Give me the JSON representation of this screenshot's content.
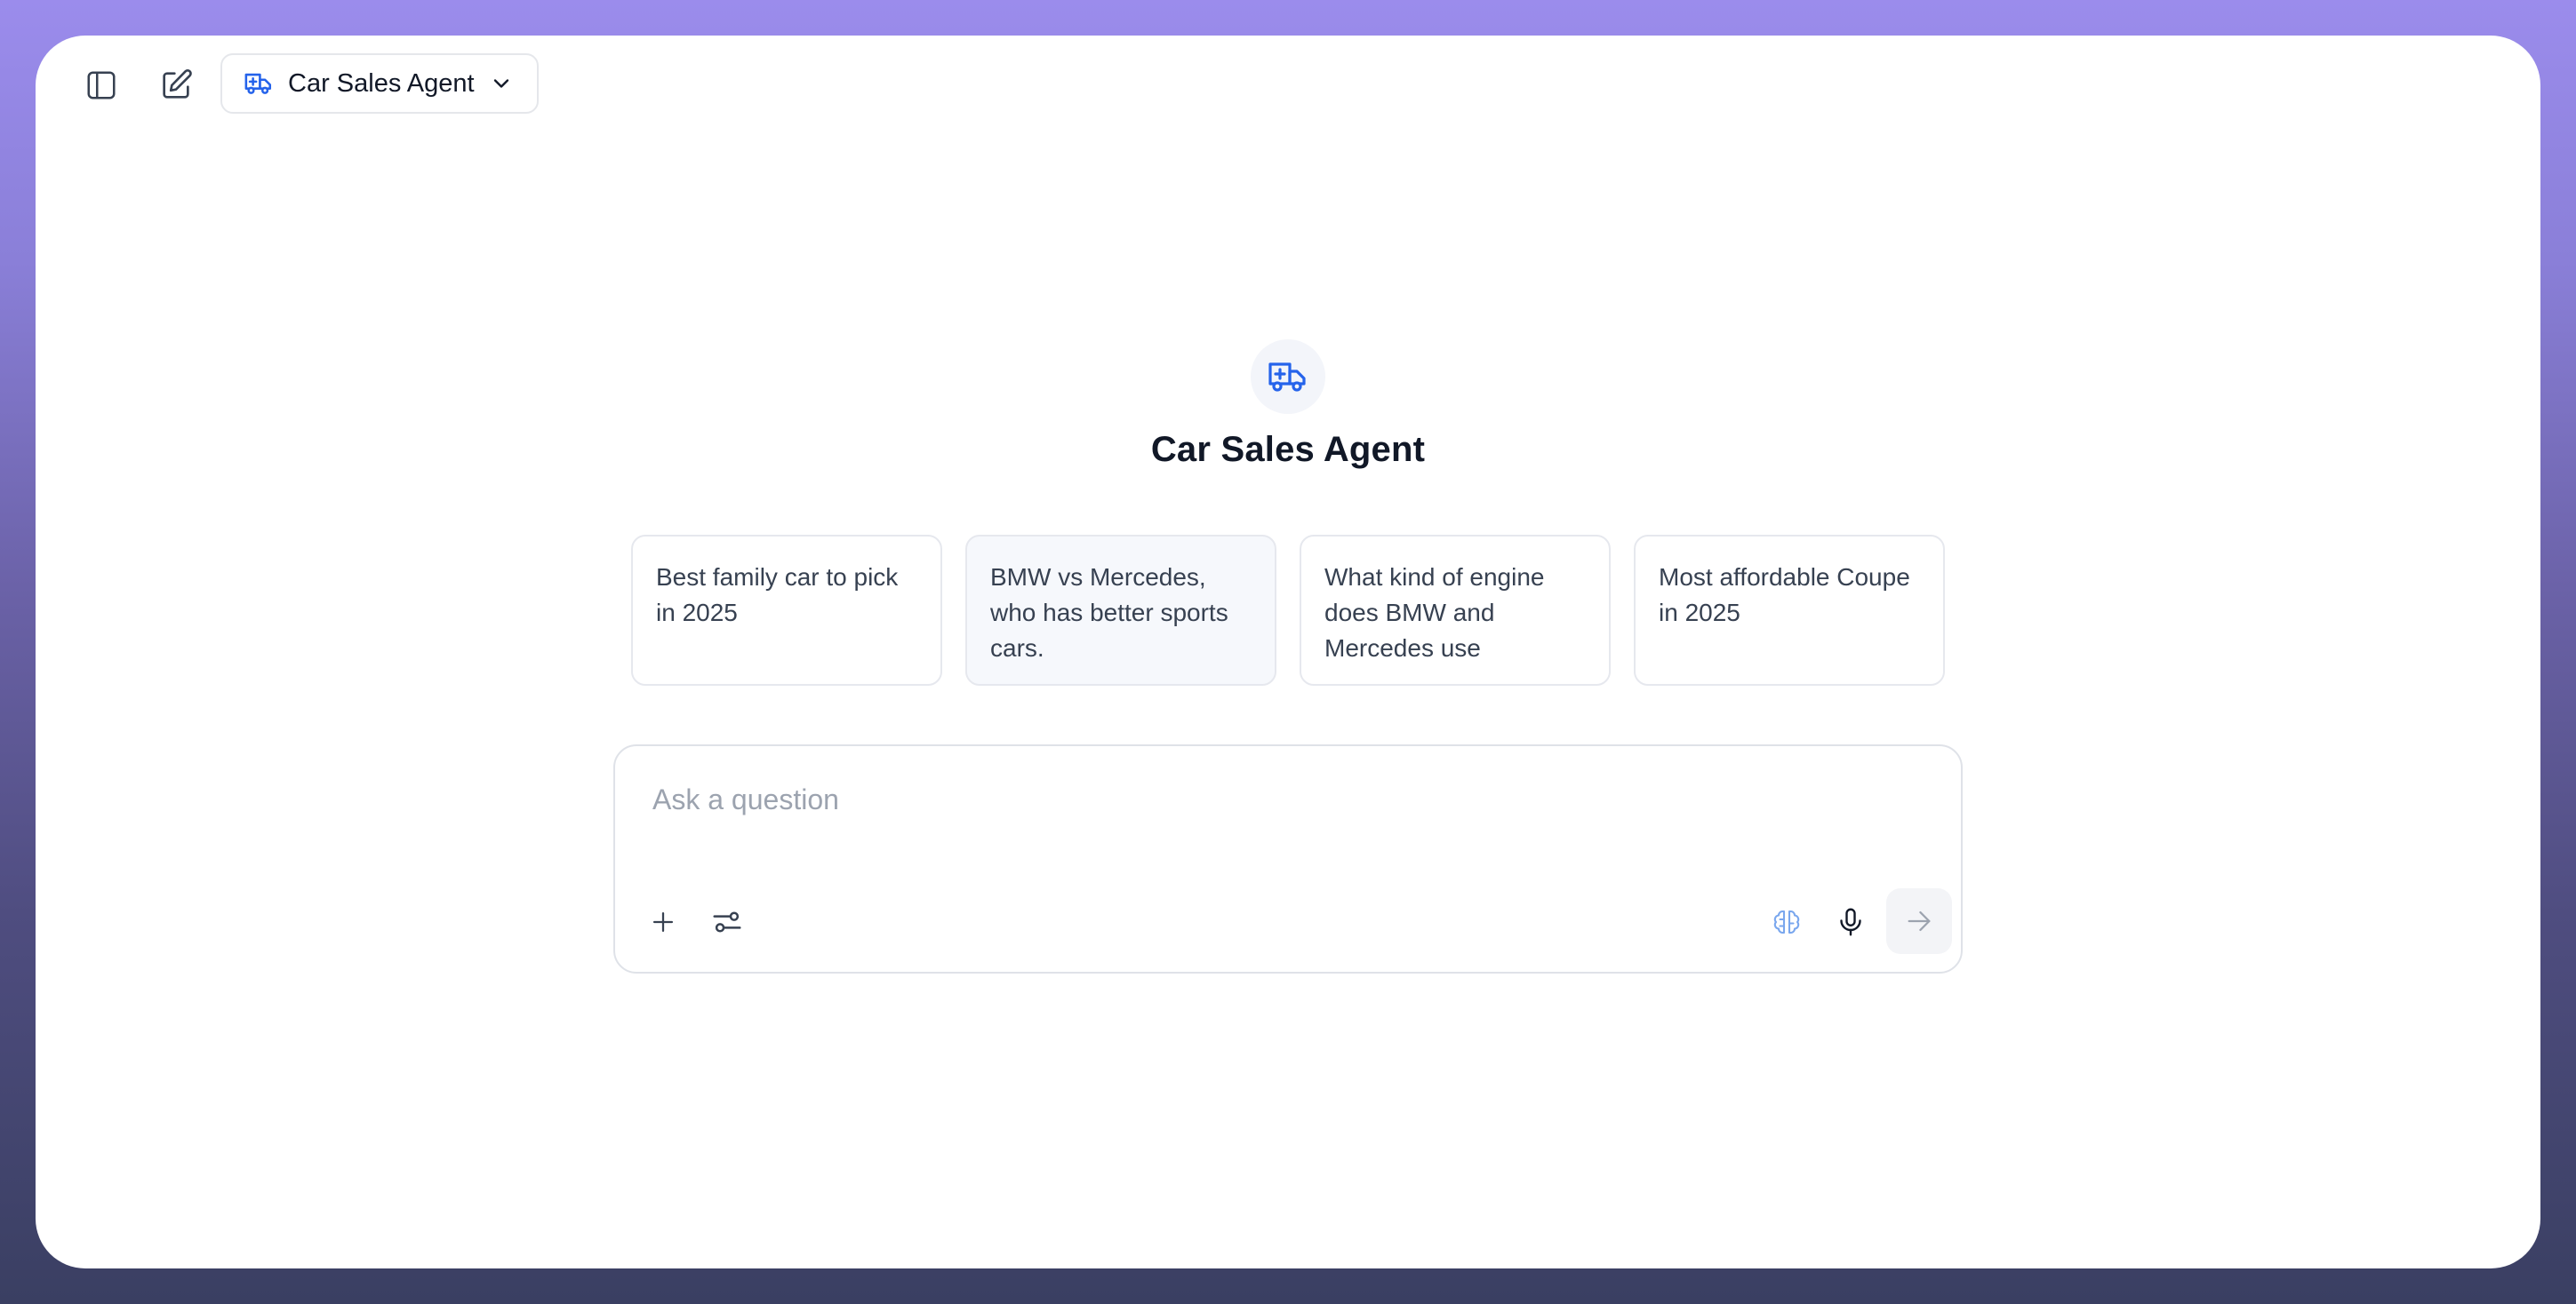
{
  "header": {
    "sidebar_toggle_icon": "sidebar-icon",
    "new_chat_icon": "edit-icon",
    "agent_selector": {
      "label": "Car Sales Agent",
      "icon": "ambulance-truck-icon",
      "chevron_icon": "chevron-down-icon"
    }
  },
  "hero": {
    "icon": "ambulance-truck-icon",
    "title": "Car Sales Agent"
  },
  "suggestions": [
    {
      "text": "Best family car to pick in 2025"
    },
    {
      "text": "BMW vs Mercedes, who has better sports cars."
    },
    {
      "text": "What kind of engine does BMW and Mercedes use"
    },
    {
      "text": "Most affordable Coupe in 2025"
    }
  ],
  "composer": {
    "value": "",
    "placeholder": "Ask a question",
    "tools": {
      "attach_icon": "plus-icon",
      "settings_icon": "sliders-icon",
      "reasoning_icon": "brain-icon",
      "mic_icon": "microphone-icon",
      "send_icon": "arrow-right-icon"
    }
  },
  "colors": {
    "accent": "#2563eb",
    "frame_top": "#9b8cec",
    "frame_bottom": "#3a3f62"
  }
}
